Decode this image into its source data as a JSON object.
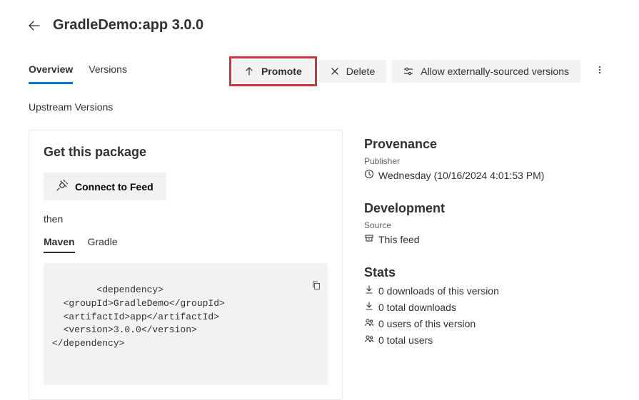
{
  "header": {
    "title": "GradleDemo:app 3.0.0"
  },
  "main_tabs": {
    "overview": "Overview",
    "versions": "Versions"
  },
  "actions": {
    "promote": "Promote",
    "delete": "Delete",
    "allow_ext": "Allow externally-sourced versions"
  },
  "upstream_heading": "Upstream Versions",
  "get_package": {
    "title": "Get this package",
    "connect": "Connect to Feed",
    "then": "then",
    "tabs": {
      "maven": "Maven",
      "gradle": "Gradle"
    },
    "code": "<dependency>\n  <groupId>GradleDemo</groupId>\n  <artifactId>app</artifactId>\n  <version>3.0.0</version>\n</dependency>"
  },
  "provenance": {
    "title": "Provenance",
    "publisher_label": "Publisher",
    "published_date": "Wednesday (10/16/2024 4:01:53 PM)"
  },
  "development": {
    "title": "Development",
    "source_label": "Source",
    "source_value": "This feed"
  },
  "stats": {
    "title": "Stats",
    "downloads_version": "0 downloads of this version",
    "downloads_total": "0 total downloads",
    "users_version": "0 users of this version",
    "users_total": "0 total users"
  }
}
